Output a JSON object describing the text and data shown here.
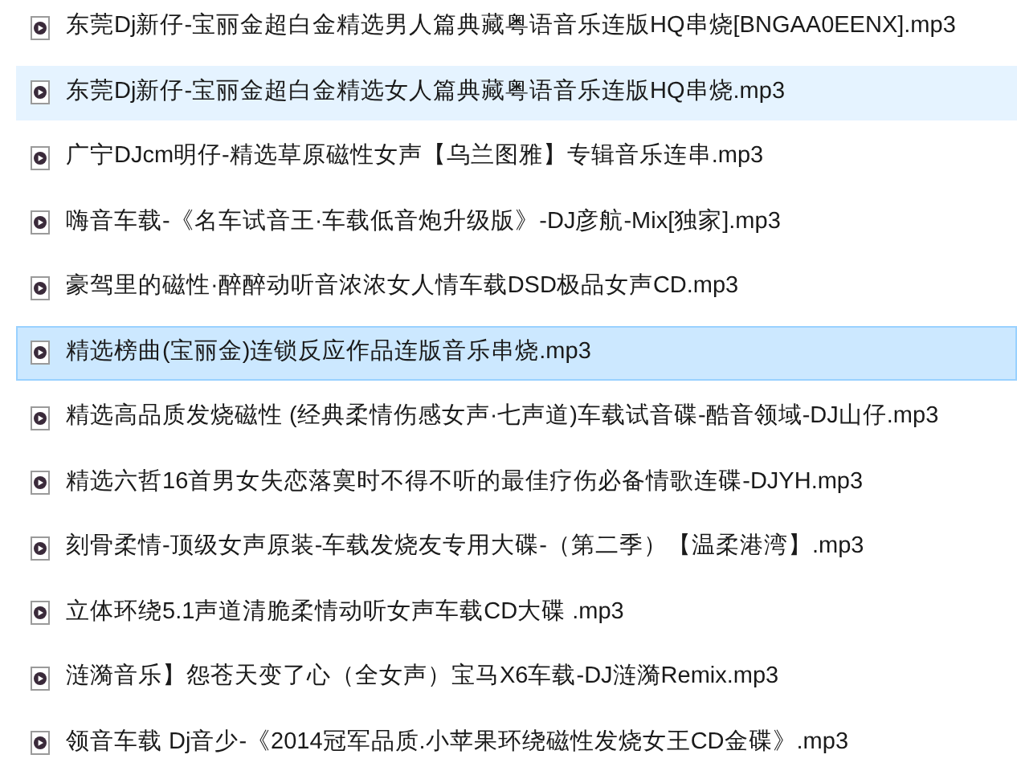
{
  "files": [
    {
      "name": "东莞Dj新仔-宝丽金超白金精选男人篇典藏粤语音乐连版HQ串烧[BNGAA0EENX].mp3",
      "selected": false,
      "hovered": false
    },
    {
      "name": "东莞Dj新仔-宝丽金超白金精选女人篇典藏粤语音乐连版HQ串烧.mp3",
      "selected": false,
      "hovered": true
    },
    {
      "name": "广宁DJcm明仔-精选草原磁性女声【乌兰图雅】专辑音乐连串.mp3",
      "selected": false,
      "hovered": false
    },
    {
      "name": "嗨音车载-《名车试音王·车载低音炮升级版》-DJ彦航-Mix[独家].mp3",
      "selected": false,
      "hovered": false
    },
    {
      "name": "豪驾里的磁性·醉醉动听音浓浓女人情车载DSD极品女声CD.mp3",
      "selected": false,
      "hovered": false
    },
    {
      "name": "精选榜曲(宝丽金)连锁反应作品连版音乐串烧.mp3",
      "selected": true,
      "hovered": false
    },
    {
      "name": "精选高品质发烧磁性 (经典柔情伤感女声·七声道)车载试音碟-酷音领域-DJ山仔.mp3",
      "selected": false,
      "hovered": false
    },
    {
      "name": "精选六哲16首男女失恋落寞时不得不听的最佳疗伤必备情歌连碟-DJYH.mp3",
      "selected": false,
      "hovered": false
    },
    {
      "name": "刻骨柔情-顶级女声原装-车载发烧友专用大碟-（第二季）【温柔港湾】.mp3",
      "selected": false,
      "hovered": false
    },
    {
      "name": "立体环绕5.1声道清脆柔情动听女声车载CD大碟 .mp3",
      "selected": false,
      "hovered": false
    },
    {
      "name": "涟漪音乐】怨苍天变了心（全女声）宝马X6车载-DJ涟漪Remix.mp3",
      "selected": false,
      "hovered": false
    },
    {
      "name": "领音车载 Dj音少-《2014冠军品质.小苹果环绕磁性发烧女王CD金碟》.mp3",
      "selected": false,
      "hovered": false
    }
  ]
}
